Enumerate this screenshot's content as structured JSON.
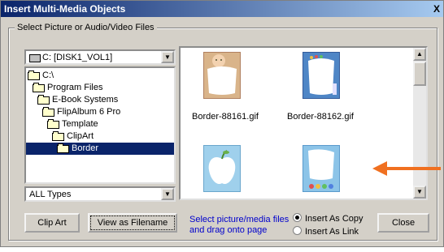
{
  "window": {
    "title": "Insert Multi-Media Objects",
    "close_glyph": "X"
  },
  "group": {
    "label": "Select Picture or Audio/Video Files"
  },
  "drive": {
    "value": "C: [DISK1_VOL1]"
  },
  "tree": {
    "items": [
      "C:\\",
      "Program Files",
      "E-Book Systems",
      "FlipAlbum 6 Pro",
      "Template",
      "ClipArt",
      "Border"
    ],
    "selected": "Border"
  },
  "file_type": {
    "value": "ALL Types"
  },
  "thumbnails": [
    {
      "name": "Border-88161.gif"
    },
    {
      "name": "Border-88162.gif"
    },
    {
      "name": ""
    },
    {
      "name": ""
    }
  ],
  "buttons": {
    "clip_art": "Clip Art",
    "view_as_filename": "View as Filename",
    "close": "Close"
  },
  "hint": {
    "line1": "Select picture/media files",
    "line2": "and drag onto page"
  },
  "insert_mode": {
    "copy": "Insert As Copy",
    "link": "Insert As Link",
    "selected": "copy"
  },
  "colors": {
    "title_bar": "#0a246a",
    "selection": "#0a246a",
    "hint_text": "#0000cc",
    "arrow": "#f07020"
  }
}
